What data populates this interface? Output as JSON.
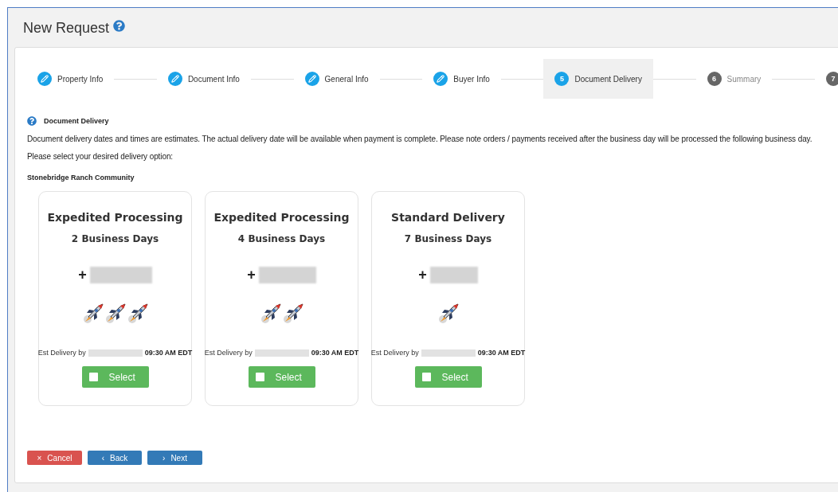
{
  "page": {
    "title": "New Request"
  },
  "steps": [
    {
      "kind": "done",
      "label": "Property Info",
      "selected": false
    },
    {
      "kind": "done",
      "label": "Document Info",
      "selected": false
    },
    {
      "kind": "done",
      "label": "General Info",
      "selected": false
    },
    {
      "kind": "done",
      "label": "Buyer Info",
      "selected": false
    },
    {
      "kind": "numbered",
      "number": "5",
      "label": "Document Delivery",
      "selected": true
    },
    {
      "kind": "numbered",
      "number": "6",
      "label": "Summary",
      "selected": false
    },
    {
      "kind": "numbered",
      "number": "7",
      "selected": false
    }
  ],
  "section": {
    "heading": "Document Delivery",
    "notice": "Document delivery dates and times are estimates. The actual delivery date will be available when payment is complete. Please note orders / payments received after the business day will be processed the following business day.",
    "prompt": "Please select your desired delivery option:",
    "community": "Stonebridge Ranch Community"
  },
  "options": [
    {
      "title": "Expedited Processing",
      "days": "2 Business Days",
      "plus": "+",
      "speed_icons": [
        {
          "kind": "rocket"
        },
        {
          "kind": "rocket"
        },
        {
          "kind": "rocket"
        }
      ],
      "est_label": "Est Delivery by",
      "est_time": "09:30 AM EDT",
      "button": "Select",
      "checked": false
    },
    {
      "title": "Expedited Processing",
      "days": "4 Business Days",
      "plus": "+",
      "speed_icons": [
        {
          "kind": "rocket"
        },
        {
          "kind": "rocket"
        }
      ],
      "est_label": "Est Delivery by",
      "est_time": "09:30 AM EDT",
      "button": "Select",
      "checked": false
    },
    {
      "title": "Standard Delivery",
      "days": "7 Business Days",
      "plus": "+",
      "speed_icons": [
        {
          "kind": "rocket"
        }
      ],
      "est_label": "Est Delivery by",
      "est_time": "09:30 AM EDT",
      "button": "Select",
      "checked": false
    }
  ],
  "footer": [
    {
      "kind": "cancel",
      "icon": "×",
      "label": "Cancel"
    },
    {
      "kind": "back",
      "icon": "‹",
      "label": "Back"
    },
    {
      "kind": "next",
      "icon": "›",
      "label": "Next"
    }
  ]
}
